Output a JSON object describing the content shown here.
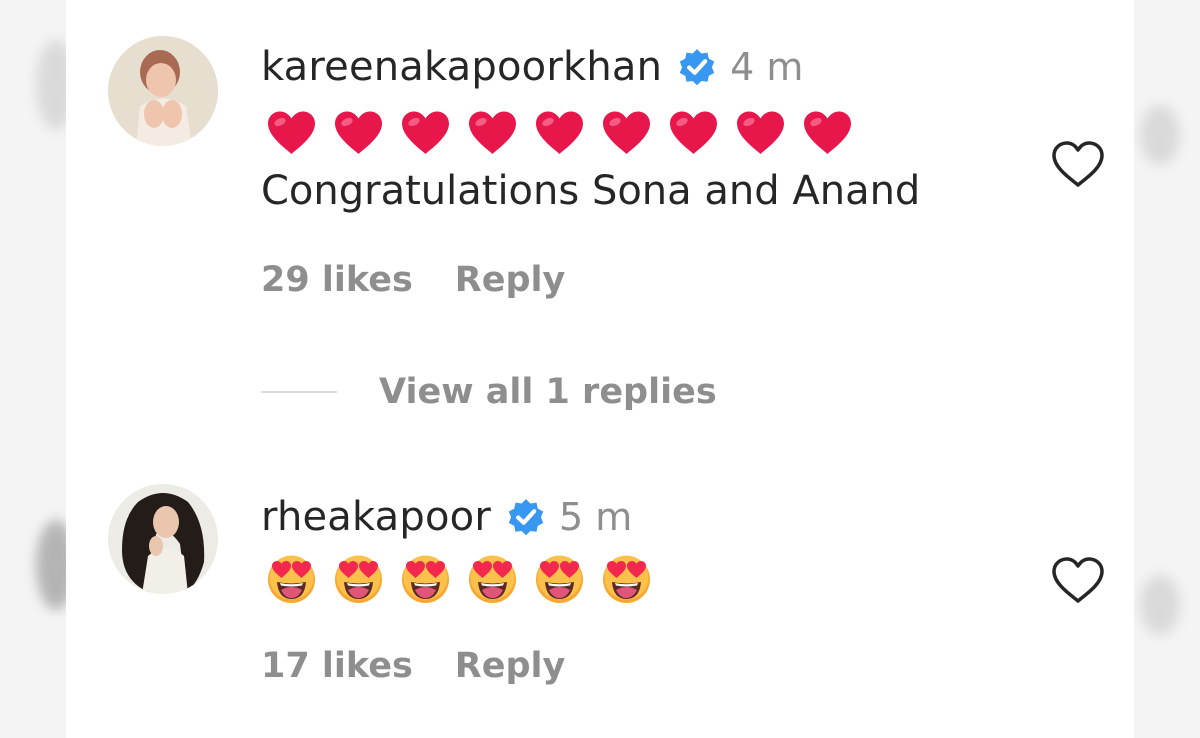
{
  "comments": [
    {
      "username": "kareenakapoorkhan",
      "time": "4 m",
      "verified_icon": "verified-badge-icon",
      "emoji_icon": "red-heart-emoji",
      "emoji_count": 9,
      "text": "Congratulations Sona and Anand",
      "likes": "29 likes",
      "reply": "Reply"
    },
    {
      "username": "rheakapoor",
      "time": "5 m",
      "verified_icon": "verified-badge-icon",
      "emoji_icon": "heart-eyes-emoji",
      "emoji_count": 6,
      "text": "",
      "likes": "17 likes",
      "reply": "Reply"
    }
  ],
  "view_replies": "View all 1 replies",
  "colors": {
    "primary_text": "#262626",
    "secondary_text": "#8e8e8e",
    "verified_blue": "#3897f0",
    "heart_red": "#e8174b",
    "divider": "#dbdbdb"
  }
}
